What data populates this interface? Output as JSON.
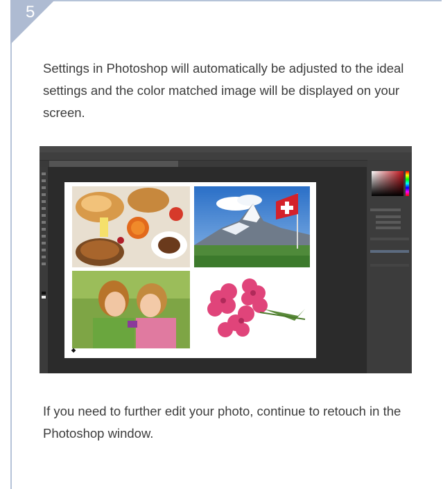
{
  "step": {
    "number": "5",
    "color": "#b5c3d8"
  },
  "paragraphs": {
    "intro": "Settings in Photoshop will automatically be adjusted to the ideal settings and the color matched image will be displayed on your screen.",
    "outro": "If you need to further edit your photo, continue to retouch in the Photoshop window."
  },
  "screenshot": {
    "app": "Photoshop",
    "photos": [
      "breakfast-photo",
      "matterhorn-swiss-flag-photo",
      "children-photo",
      "pink-flowers-photo"
    ]
  }
}
